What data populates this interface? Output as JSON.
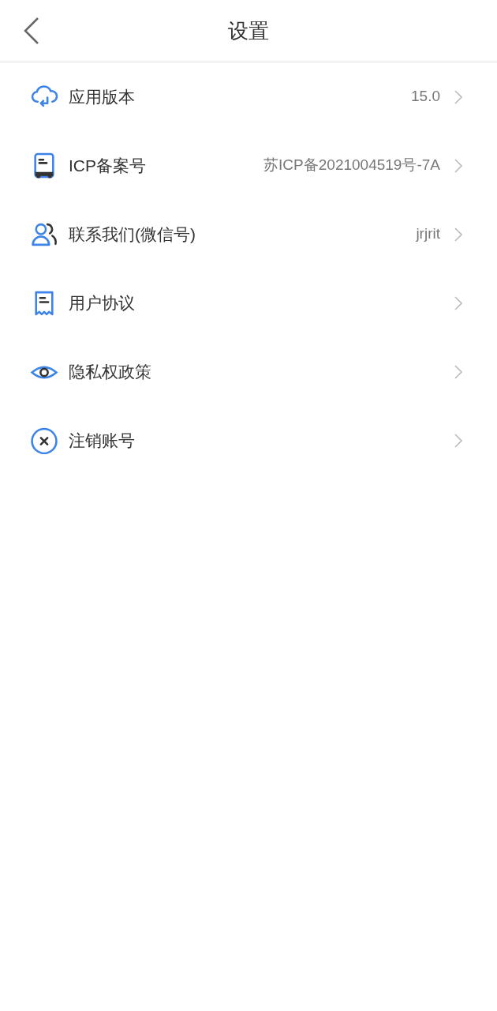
{
  "header": {
    "title": "设置"
  },
  "items": [
    {
      "kind": "cloud",
      "label": "应用版本",
      "value": "15.0"
    },
    {
      "kind": "device",
      "label": "ICP备案号",
      "value": "苏ICP备2021004519号-7A"
    },
    {
      "kind": "contacts",
      "label": "联系我们(微信号)",
      "value": "jrjrit"
    },
    {
      "kind": "document",
      "label": "用户协议"
    },
    {
      "kind": "eye",
      "label": "隐私权政策"
    },
    {
      "kind": "cancel",
      "label": "注销账号"
    }
  ]
}
